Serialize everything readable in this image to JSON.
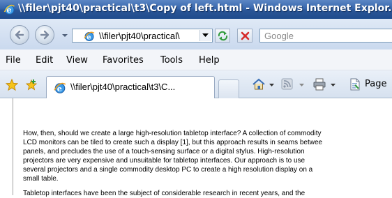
{
  "window": {
    "title": "\\\\filer\\pjt40\\practical\\t3\\Copy of left.html - Windows Internet Explor..."
  },
  "address_bar": {
    "value": "\\\\filer\\pjt40\\practical\\"
  },
  "search": {
    "placeholder": "Google"
  },
  "menu": [
    "File",
    "Edit",
    "View",
    "Favorites",
    "Tools",
    "Help"
  ],
  "tab": {
    "label": "\\\\filer\\pjt40\\practical\\t3\\C..."
  },
  "commands": {
    "page_label": "Page"
  },
  "icons": [
    "ie-logo-icon",
    "back-arrow-icon",
    "forward-arrow-icon",
    "refresh-icon",
    "stop-icon",
    "favorites-star-icon",
    "add-favorites-icon",
    "home-icon",
    "feeds-icon",
    "print-icon",
    "page-icon"
  ],
  "content": {
    "paragraphs": [
      [
        "How, then, should we create a large high-resolution tabletop interface? A collection of commodity",
        "LCD monitors can be tiled to create such a display [1], but this approach results in seams betwee",
        "panels, and precludes the use of a touch-sensing surface or a digital stylus. High-resolution",
        "projectors are very expensive and unsuitable for tabletop interfaces. Our approach is to use",
        "several projectors and a single commodity desktop PC to create a high resolution display on a",
        "small table."
      ],
      [
        "Tabletop interfaces have been the subject of considerable research in recent years, and the"
      ]
    ]
  }
}
